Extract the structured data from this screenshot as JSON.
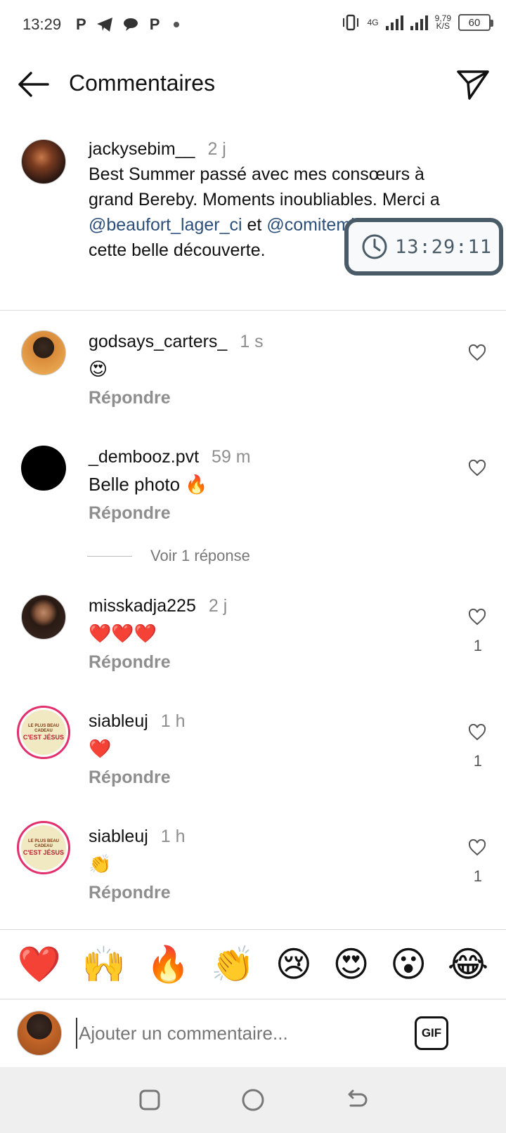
{
  "status_bar": {
    "time": "13:29",
    "app_icons": [
      "P",
      "P"
    ],
    "network_type": "4G",
    "speed_value": "9,79",
    "speed_unit": "K/S",
    "battery": "60"
  },
  "header": {
    "title": "Commentaires"
  },
  "caption": {
    "username": "jackysebim__",
    "time": "2 j",
    "text_part1": "Best Summer passé avec mes consœurs à grand Bereby. Moments inoubliables. Merci a ",
    "mention1": "@beaufort_lager_ci",
    "text_part2": " et ",
    "mention2": "@comitemissci",
    "text_part3": " pour cette belle découverte."
  },
  "timer_overlay": {
    "time": "13:29:11"
  },
  "comments": [
    {
      "username": "godsays_carters_",
      "time": "1 s",
      "text": "😍",
      "reply": "Répondre",
      "likes": ""
    },
    {
      "username": "_dembooz.pvt",
      "time": "59 m",
      "text": "Belle photo 🔥",
      "reply": "Répondre",
      "likes": ""
    },
    {
      "username": "misskadja225",
      "time": "2 j",
      "text": "❤️❤️❤️",
      "reply": "Répondre",
      "likes": "1"
    },
    {
      "username": "siableuj",
      "time": "1 h",
      "text": "❤️",
      "reply": "Répondre",
      "likes": "1"
    },
    {
      "username": "siableuj",
      "time": "1 h",
      "text": "👏",
      "reply": "Répondre",
      "likes": "1"
    }
  ],
  "view_replies": "Voir 1 réponse",
  "avatar_text": {
    "siableuj_line1": "LE PLUS BEAU CADEAU",
    "siableuj_line2": "C'EST JÉSUS"
  },
  "emoji_bar": [
    "❤️",
    "🙌",
    "🔥",
    "👏",
    "😢",
    "😍",
    "😮",
    "😂"
  ],
  "composer": {
    "placeholder": "Ajouter un commentaire...",
    "gif_label": "GIF"
  },
  "colors": {
    "mention": "#2b4f7a",
    "muted": "#8e8e8e",
    "story_ring": "#e1306c",
    "timer_border": "#4a5b68"
  }
}
